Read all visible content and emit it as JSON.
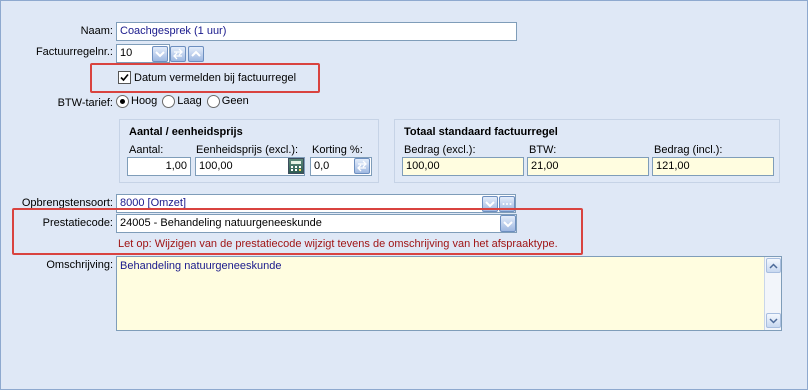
{
  "form": {
    "naam": {
      "label": "Naam:",
      "value": "Coachgesprek (1 uur)"
    },
    "factuurregelnr": {
      "label": "Factuurregelnr.:",
      "value": "10"
    },
    "datum_vermelden": {
      "label": "Datum vermelden bij factuurregel",
      "checked": true
    },
    "btw_tarief": {
      "label": "BTW-tarief:",
      "options": [
        "Hoog",
        "Laag",
        "Geen"
      ],
      "selected": "Hoog"
    },
    "aantal_group": {
      "title": "Aantal / eenheidsprijs",
      "aantal_label": "Aantal:",
      "aantal_value": "1,00",
      "eenheidsprijs_label": "Eenheidsprijs (excl.):",
      "eenheidsprijs_value": "100,00",
      "korting_label": "Korting %:",
      "korting_value": "0,0"
    },
    "totaal_group": {
      "title": "Totaal standaard factuurregel",
      "bedrag_excl_label": "Bedrag (excl.):",
      "bedrag_excl_value": "100,00",
      "btw_label": "BTW:",
      "btw_value": "21,00",
      "bedrag_incl_label": "Bedrag (incl.):",
      "bedrag_incl_value": "121,00"
    },
    "opbrengstensoort": {
      "label": "Opbrengstensoort:",
      "value": "8000 [Omzet]"
    },
    "prestatiecode": {
      "label": "Prestatiecode:",
      "value": "24005 - Behandeling natuurgeneeskunde",
      "warning": "Let op: Wijzigen van de prestatiecode wijzigt tevens de omschrijving van het afspraaktype."
    },
    "omschrijving": {
      "label": "Omschrijving:",
      "value": "Behandeling natuurgeneeskunde"
    }
  },
  "colors": {
    "panel_bg": "#dfe8f6",
    "highlight_red": "#d9433f",
    "warning_text": "#a01515",
    "readonly_yellow": "#fffde0"
  },
  "icons": [
    "chevron-down-icon",
    "swap-arrows-icon",
    "chevron-up-icon",
    "calculator-icon",
    "scroll-up-icon",
    "scroll-down-icon",
    "ellipsis-icon"
  ]
}
